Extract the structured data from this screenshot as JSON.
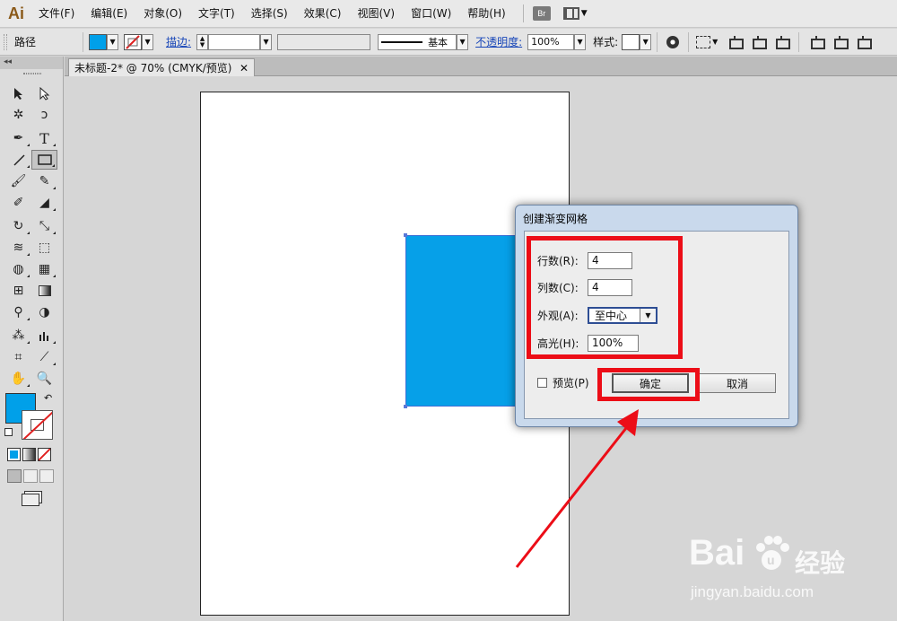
{
  "app": {
    "logo_text": "Ai",
    "menus": [
      "文件(F)",
      "编辑(E)",
      "对象(O)",
      "文字(T)",
      "选择(S)",
      "效果(C)",
      "视图(V)",
      "窗口(W)",
      "帮助(H)"
    ],
    "bridge_label": "Br"
  },
  "controlbar": {
    "object_label": "路径",
    "stroke_label": "描边:",
    "stroke_profile": "基本",
    "opacity_label": "不透明度:",
    "opacity_value": "100%",
    "style_label": "样式:"
  },
  "tools_panel": {
    "collapse_label": "◂◂"
  },
  "document": {
    "tab_title": "未标题-2* @ 70% (CMYK/预览)",
    "close_glyph": "✕"
  },
  "colors": {
    "fill": "#00a0e9",
    "annotation_red": "#ec0d17"
  },
  "dialog": {
    "title": "创建渐变网格",
    "rows_label": "行数(R):",
    "rows_value": "4",
    "cols_label": "列数(C):",
    "cols_value": "4",
    "appearance_label": "外观(A):",
    "appearance_value": "至中心",
    "highlight_label": "高光(H):",
    "highlight_value": "100%",
    "preview_label": "预览(P)",
    "ok_label": "确定",
    "cancel_label": "取消"
  },
  "watermark": {
    "brand": "Bai",
    "brand_cn": "经验",
    "url": "jingyan.baidu.com"
  }
}
